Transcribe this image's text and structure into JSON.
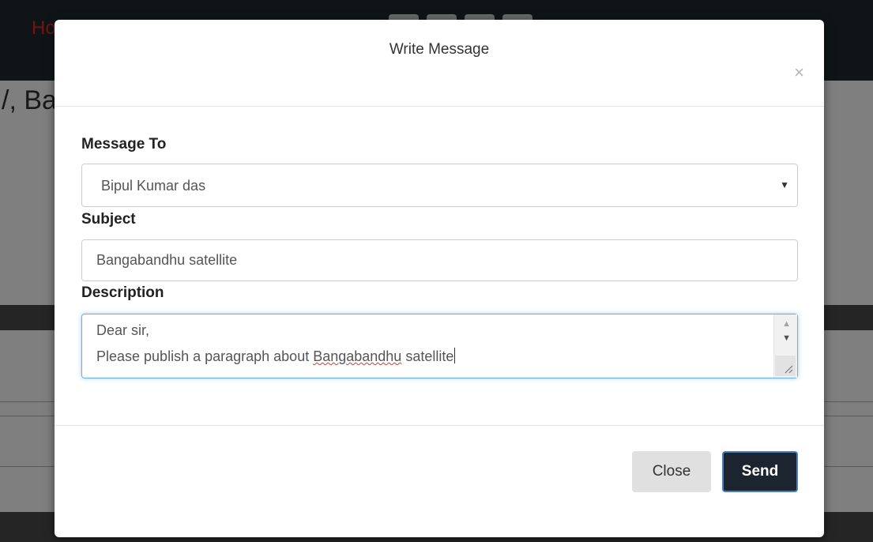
{
  "background": {
    "nav_brand": "Ho",
    "heading_fragment": "/, Ba"
  },
  "modal": {
    "title": "Write Message",
    "close_icon": "close-icon",
    "message_to": {
      "label": "Message To",
      "selected": "Bipul Kumar das"
    },
    "subject": {
      "label": "Subject",
      "value": "Bangabandhu satellite"
    },
    "description": {
      "label": "Description",
      "line1": "Dear sir,",
      "line2_prefix": "Please publish a paragraph about ",
      "line2_misspelled": "Bangabandhu",
      "line2_suffix": " satellite"
    },
    "buttons": {
      "close": "Close",
      "send": "Send"
    }
  },
  "colors": {
    "send_button": "#1c2430",
    "focus_border": "#66afe9",
    "nav_brand": "#e8262a"
  }
}
